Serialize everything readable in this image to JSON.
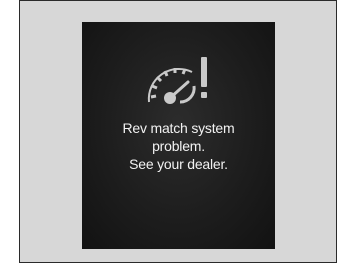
{
  "warning": {
    "icon": "rev-match-warning-icon",
    "message_lines": [
      "Rev match system",
      "problem.",
      "See your dealer."
    ]
  },
  "colors": {
    "frame_background": "#d7d7d7",
    "screen_background": "#1d1d1d",
    "text": "#f2f2f2",
    "icon": "#c9c9c9"
  }
}
